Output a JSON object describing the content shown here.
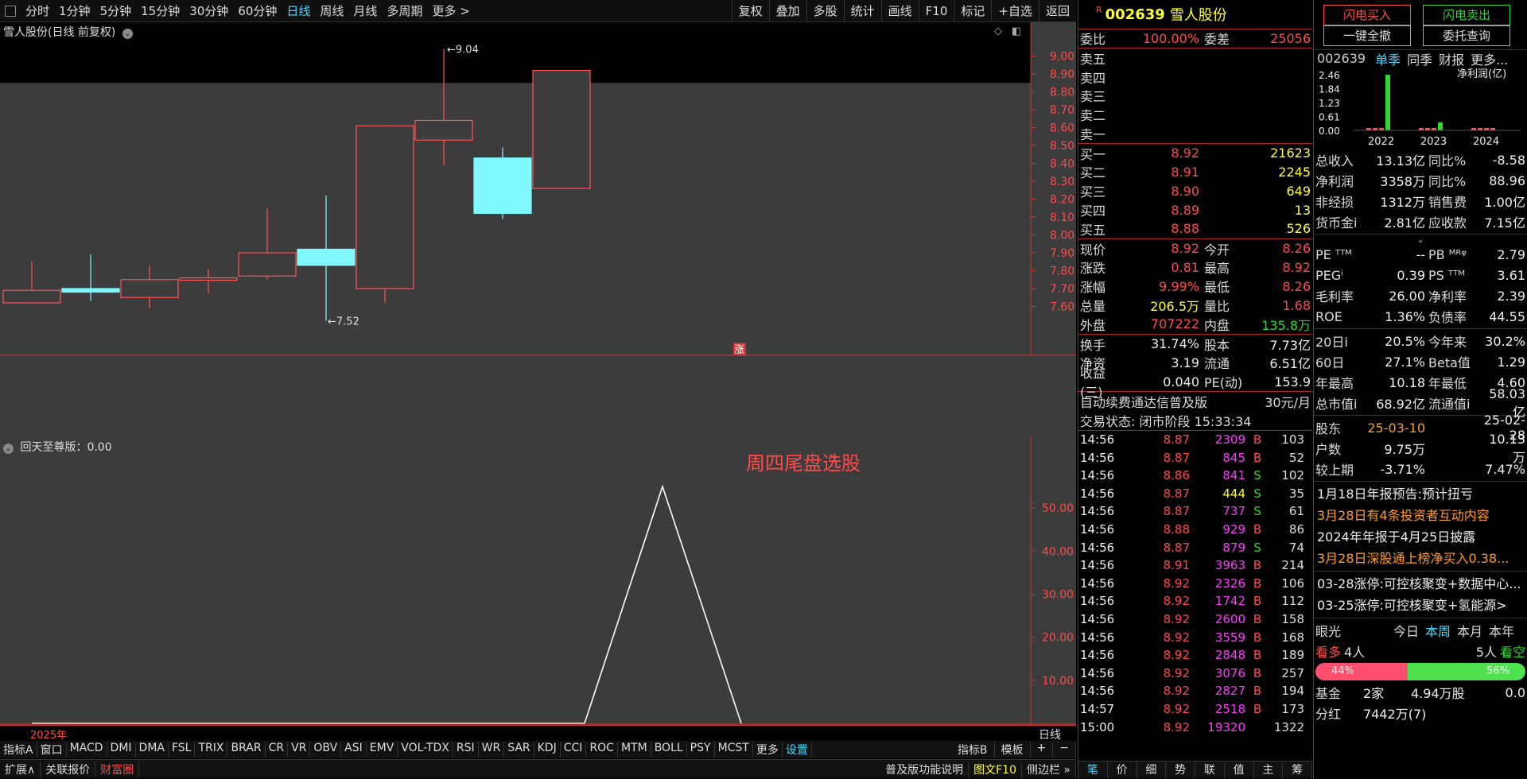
{
  "period_bar": {
    "items": [
      "分时",
      "1分钟",
      "5分钟",
      "15分钟",
      "30分钟",
      "60分钟",
      "日线",
      "周线",
      "月线",
      "多周期",
      "更多 >"
    ],
    "active": "日线",
    "tools": [
      "复权",
      "叠加",
      "多股",
      "统计",
      "画线",
      "F10",
      "标记",
      "+自选",
      "返回"
    ]
  },
  "chart": {
    "title": "雪人股份(日线 前复权)",
    "high_label": "9.04",
    "low_label": "7.52",
    "limit_up_marker": "涨",
    "year_label": "2025年",
    "period_label": "日线",
    "y_ticks": [
      "9.00",
      "8.90",
      "8.80",
      "8.70",
      "8.60",
      "8.50",
      "8.40",
      "8.30",
      "8.20",
      "8.10",
      "8.00",
      "7.90",
      "7.80",
      "7.70",
      "7.60"
    ]
  },
  "chart_data": [
    {
      "type": "candlestick",
      "title": "雪人股份(日线 前复权)",
      "ylim": [
        7.5,
        9.1
      ],
      "candles": [
        {
          "open": 7.62,
          "close": 7.69,
          "high": 7.85,
          "low": 7.62,
          "direction": "up"
        },
        {
          "open": 7.7,
          "close": 7.68,
          "high": 7.89,
          "low": 7.63,
          "direction": "down"
        },
        {
          "open": 7.65,
          "close": 7.75,
          "high": 7.83,
          "low": 7.59,
          "direction": "up"
        },
        {
          "open": 7.75,
          "close": 7.76,
          "high": 7.81,
          "low": 7.67,
          "direction": "up"
        },
        {
          "open": 7.77,
          "close": 7.9,
          "high": 8.15,
          "low": 7.75,
          "direction": "up"
        },
        {
          "open": 7.92,
          "close": 7.83,
          "high": 8.22,
          "low": 7.52,
          "direction": "down"
        },
        {
          "open": 7.7,
          "close": 8.61,
          "high": 8.61,
          "low": 7.62,
          "direction": "up"
        },
        {
          "open": 8.53,
          "close": 8.64,
          "high": 9.04,
          "low": 8.39,
          "direction": "up"
        },
        {
          "open": 8.43,
          "close": 8.12,
          "high": 8.49,
          "low": 8.09,
          "direction": "down"
        },
        {
          "open": 8.26,
          "close": 8.92,
          "high": 8.92,
          "low": 8.26,
          "direction": "up"
        }
      ]
    },
    {
      "type": "line",
      "title": "回天至尊版：0.00",
      "ylim": [
        0,
        60
      ],
      "y_ticks": [
        10,
        20,
        30,
        40,
        50
      ],
      "annotation": "周四尾盘选股",
      "series": [
        {
          "values": [
            0,
            0,
            0,
            0,
            0,
            0,
            0,
            0,
            0,
            0,
            0,
            0,
            0,
            0,
            0,
            0,
            0,
            0,
            0,
            0,
            0,
            0,
            0,
            0,
            0,
            0,
            0,
            0,
            0,
            0,
            0,
            0,
            0,
            0,
            0,
            0,
            0,
            0,
            0,
            55,
            0
          ]
        }
      ]
    }
  ],
  "sub_chart": {
    "title": "回天至尊版：0.00",
    "annotation": "周四尾盘选股",
    "y_ticks": [
      "50.00",
      "40.00",
      "30.00",
      "20.00",
      "10.00"
    ]
  },
  "indicator_bar": {
    "items": [
      "指标A",
      "窗口",
      "MACD",
      "DMI",
      "DMA",
      "FSL",
      "TRIX",
      "BRAR",
      "CR",
      "VR",
      "OBV",
      "ASI",
      "EMV",
      "VOL-TDX",
      "RSI",
      "WR",
      "SAR",
      "KDJ",
      "CCI",
      "ROC",
      "MTM",
      "BOLL",
      "PSY",
      "MCST",
      "更多",
      "设置"
    ],
    "right": [
      "指标B",
      "模板",
      "+",
      "−"
    ]
  },
  "status_bar": {
    "items": [
      "扩展∧",
      "关联报价",
      "财富圈"
    ],
    "right": [
      "普及版功能说明",
      "图文F10",
      "侧边栏 »"
    ]
  },
  "quote": {
    "code": "002639",
    "name": "雪人股份",
    "r_marker": "R",
    "weibi_label": "委比",
    "weibi": "100.00%",
    "weicha_label": "委差",
    "weicha": "25056",
    "sells": [
      "卖五",
      "卖四",
      "卖三",
      "卖二",
      "卖一"
    ],
    "buys": [
      {
        "label": "买一",
        "price": "8.92",
        "vol": "21623"
      },
      {
        "label": "买二",
        "price": "8.91",
        "vol": "2245"
      },
      {
        "label": "买三",
        "price": "8.90",
        "vol": "649"
      },
      {
        "label": "买四",
        "price": "8.89",
        "vol": "13"
      },
      {
        "label": "买五",
        "price": "8.88",
        "vol": "526"
      }
    ],
    "stats": [
      {
        "l1": "现价",
        "v1": "8.92",
        "l2": "今开",
        "v2": "8.26"
      },
      {
        "l1": "涨跌",
        "v1": "0.81",
        "l2": "最高",
        "v2": "8.92"
      },
      {
        "l1": "涨幅",
        "v1": "9.99%",
        "l2": "最低",
        "v2": "8.26"
      },
      {
        "l1": "总量",
        "v1": "206.5万",
        "l2": "量比",
        "v2": "1.68"
      },
      {
        "l1": "外盘",
        "v1": "707222",
        "l2": "内盘",
        "v2": "135.8万"
      }
    ],
    "stats2": [
      {
        "l1": "换手",
        "v1": "31.74%",
        "l2": "股本",
        "v2": "7.73亿"
      },
      {
        "l1": "净资",
        "v1": "3.19",
        "l2": "流通",
        "v2": "6.51亿"
      },
      {
        "l1": "收益(三)",
        "v1": "0.040",
        "l2": "PE(动)",
        "v2": "153.9"
      }
    ],
    "promo": "自动续费通达信普及版",
    "promo_price": "30元/月",
    "trade_status": "交易状态: 闭市阶段 15:33:34",
    "ticks": [
      {
        "t": "14:56",
        "p": "8.87",
        "v": "2309",
        "bs": "B",
        "n": "103"
      },
      {
        "t": "14:56",
        "p": "8.87",
        "v": "845",
        "bs": "B",
        "n": "52"
      },
      {
        "t": "14:56",
        "p": "8.86",
        "v": "841",
        "bs": "S",
        "n": "102"
      },
      {
        "t": "14:56",
        "p": "8.87",
        "v": "444",
        "bs": "S",
        "n": "35"
      },
      {
        "t": "14:56",
        "p": "8.87",
        "v": "737",
        "bs": "S",
        "n": "61"
      },
      {
        "t": "14:56",
        "p": "8.88",
        "v": "929",
        "bs": "B",
        "n": "86"
      },
      {
        "t": "14:56",
        "p": "8.87",
        "v": "879",
        "bs": "S",
        "n": "74"
      },
      {
        "t": "14:56",
        "p": "8.91",
        "v": "3963",
        "bs": "B",
        "n": "214"
      },
      {
        "t": "14:56",
        "p": "8.92",
        "v": "2326",
        "bs": "B",
        "n": "106"
      },
      {
        "t": "14:56",
        "p": "8.92",
        "v": "1742",
        "bs": "B",
        "n": "112"
      },
      {
        "t": "14:56",
        "p": "8.92",
        "v": "2600",
        "bs": "B",
        "n": "158"
      },
      {
        "t": "14:56",
        "p": "8.92",
        "v": "3559",
        "bs": "B",
        "n": "168"
      },
      {
        "t": "14:56",
        "p": "8.92",
        "v": "2848",
        "bs": "B",
        "n": "189"
      },
      {
        "t": "14:56",
        "p": "8.92",
        "v": "3076",
        "bs": "B",
        "n": "257"
      },
      {
        "t": "14:56",
        "p": "8.92",
        "v": "2827",
        "bs": "B",
        "n": "194"
      },
      {
        "t": "14:57",
        "p": "8.92",
        "v": "2518",
        "bs": "B",
        "n": "173"
      },
      {
        "t": "15:00",
        "p": "8.92",
        "v": "19320",
        "bs": "",
        "n": "1322"
      }
    ],
    "bottom_tabs": [
      "笔",
      "价",
      "细",
      "势",
      "联",
      "值",
      "主",
      "筹"
    ]
  },
  "f10": {
    "btn_buy": "闪电买入",
    "btn_sell": "闪电卖出",
    "btn_cancel_all": "一键全撤",
    "btn_query": "委托查询",
    "code": "002639",
    "tabs": [
      "单季",
      "同季",
      "财报",
      "更多..."
    ],
    "chart_title": "净利润(亿)",
    "chart_y": [
      "2.46",
      "1.84",
      "1.23",
      "0.61",
      "0.00"
    ],
    "chart_years": [
      "2022",
      "2023",
      "2024"
    ],
    "fin": [
      {
        "a": "总收入",
        "b": "13.13亿",
        "c": "同比%",
        "d": "-8.58"
      },
      {
        "a": "净利润",
        "b": "3358万",
        "c": "同比%",
        "d": "88.96"
      },
      {
        "a": "非经损",
        "b": "1312万",
        "c": "销售费",
        "d": "1.00亿"
      },
      {
        "a": "货币金i",
        "b": "2.81亿",
        "c": "应收款",
        "d": "7.15亿"
      }
    ],
    "val": [
      {
        "a": "PE ᵀᵀᴹ",
        "b": "--",
        "c": "PB ᴹᴿᵠ",
        "d": "2.79"
      },
      {
        "a": "PEGⁱ",
        "b": "0.39",
        "c": "PS ᵀᵀᴹ",
        "d": "3.61"
      },
      {
        "a": "毛利率",
        "b": "26.00",
        "c": "净利率",
        "d": "2.39"
      },
      {
        "a": "ROE",
        "b": "1.36%",
        "c": "负债率",
        "d": "44.55"
      }
    ],
    "perf": [
      {
        "a": "20日i",
        "b": "20.5%",
        "c": "今年来",
        "d": "30.2%"
      },
      {
        "a": "60日",
        "b": "27.1%",
        "c": "Beta值",
        "d": "1.29"
      },
      {
        "a": "年最高",
        "b": "10.18",
        "c": "年最低",
        "d": "4.60"
      },
      {
        "a": "总市值i",
        "b": "68.92亿",
        "c": "流通值i",
        "d": "58.03亿"
      }
    ],
    "holders": [
      {
        "a": "股东",
        "b": "25-03-10",
        "d": "25-02-28"
      },
      {
        "a": "户数",
        "b": "9.75万",
        "d": "10.13万"
      },
      {
        "a": "较上期",
        "b": "-3.71%",
        "d": "7.47%"
      }
    ],
    "news": [
      {
        "text": "1月18日年报预告:预计扭亏",
        "color": "#eee"
      },
      {
        "text": "3月28日有4条投资者互动内容",
        "color": "#ff9c2a"
      },
      {
        "text": "2024年年报于4月25日披露",
        "color": "#eee"
      },
      {
        "text": "3月28日深股通上榜净买入0.38...",
        "color": "#ff9c2a"
      }
    ],
    "concepts": [
      "03-28涨停:可控核聚变+数据中心...",
      "03-25涨停:可控核聚变+氢能源>"
    ],
    "vision": {
      "label": "眼光",
      "tabs": [
        "今日",
        "本周",
        "本月",
        "本年"
      ],
      "active": "本周"
    },
    "bulls_label": "看多",
    "bulls_count": "4人",
    "bears_count": "5人",
    "bears_label": "看空",
    "bulls_pct": "44%",
    "bears_pct": "56%",
    "fund_label": "基金",
    "fund_count": "2家",
    "fund_shares": "4.94万股",
    "fund_pct": "0.0",
    "bottom_label": "分红",
    "bottom_value": "7442万(7)"
  }
}
